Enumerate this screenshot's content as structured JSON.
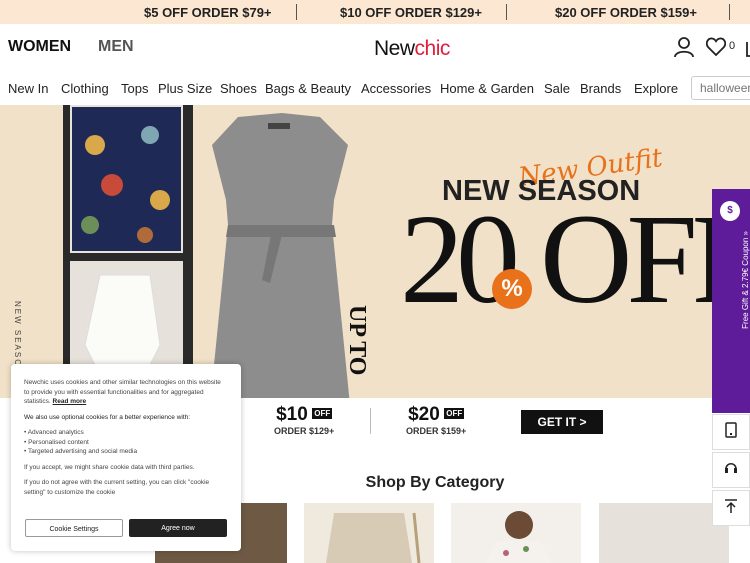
{
  "promo": {
    "offers": [
      "$5 OFF ORDER $79+",
      "$10 OFF ORDER $129+",
      "$20 OFF ORDER $159+"
    ]
  },
  "header": {
    "women": "WOMEN",
    "men": "MEN",
    "logo_left": "New",
    "logo_right": "chic",
    "wishlist_count": "0",
    "icons": [
      "user-icon",
      "heart-icon",
      "bag-icon"
    ]
  },
  "nav": {
    "items": [
      "New In",
      "Clothing",
      "Tops",
      "Plus Size",
      "Shoes",
      "Bags & Beauty",
      "Accessories",
      "Home & Garden",
      "Sale",
      "Brands",
      "Explore"
    ],
    "search_placeholder": "halloween"
  },
  "banner": {
    "vertical_text": "NEW SEASON NEW OUTFIT ///",
    "script_text": "New Outfit",
    "headline": "NEW SEASON",
    "up_to": "UP TO",
    "discount_left": "20",
    "percent": "%",
    "discount_right": "OFF"
  },
  "coupons": [
    {
      "amount": "$10",
      "off": "OFF",
      "order": "ORDER $129+"
    },
    {
      "amount": "$20",
      "off": "OFF",
      "order": "ORDER $159+"
    }
  ],
  "cta": "GET IT >",
  "section_title": "Shop By Category",
  "side_tab": {
    "badge": "$",
    "label": "Free Gift & 2.79€ Coupon »"
  },
  "cookie": {
    "intro": "Newchic uses cookies and other similar technologies on this website to provide you with essential functionalities and for aggregated statistics.",
    "read_more": "Read more",
    "optional_title": "We also use optional cookies for a better experience with:",
    "optional_items": [
      "• Advanced analytics",
      "• Personalised content",
      "• Targeted advertising and social media"
    ],
    "share_note": "If you accept, we might share cookie data with third parties.",
    "disagree_note": "If you do not agree with the current setting, you can click \"cookie setting\" to customize the cookie",
    "settings_button": "Cookie Settings",
    "agree_button": "Agree now"
  },
  "colors": {
    "promo_bg": "#fbe7d2",
    "banner_bg": "#f1e1c8",
    "accent_orange": "#e8711a",
    "logo_red": "#e01f3d",
    "side_tab": "#5e1b9a"
  }
}
